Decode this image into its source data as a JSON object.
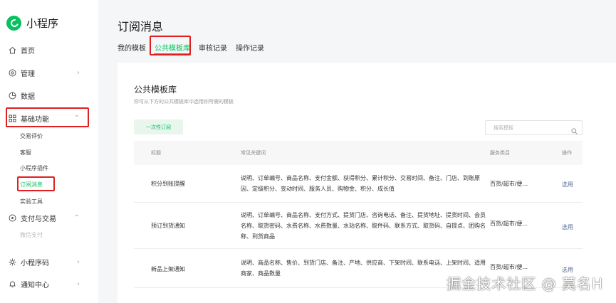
{
  "app": {
    "name": "小程序"
  },
  "sidebar": {
    "items": [
      {
        "label": "首页",
        "icon": "home-icon"
      },
      {
        "label": "管理",
        "icon": "manage-icon"
      },
      {
        "label": "数据",
        "icon": "data-icon"
      },
      {
        "label": "基础功能",
        "icon": "grid-icon"
      },
      {
        "label": "支付与交易",
        "icon": "payment-icon"
      },
      {
        "label": "小程序码",
        "icon": "qrcode-icon"
      },
      {
        "label": "通知中心",
        "icon": "bell-icon"
      }
    ],
    "basic_sub": [
      "交易评价",
      "客服",
      "小程序插件",
      "订阅消息",
      "实验工具"
    ],
    "pay_sub": [
      "微信支付"
    ]
  },
  "header": {
    "title": "订阅消息",
    "tabs": [
      "我的模板",
      "公共模板库",
      "审核记录",
      "操作记录"
    ]
  },
  "main": {
    "title": "公共模板库",
    "subtitle": "你可从下方的公共模板库中选用你所需的模板",
    "once_button": "一次性订阅",
    "search_placeholder": "搜索模板",
    "columns": [
      "标题",
      "常见关键词",
      "服务类目",
      "操作"
    ],
    "rows": [
      {
        "title": "积分到账提醒",
        "keywords": "说明、订单编号、商品名称、支付金额、获得积分、累计积分、交易时间、备注、门店、到账原因、定级积分、变动时间、服务人员、购物金、积分、成长值",
        "category": "百货/超市/便...",
        "action": "选用"
      },
      {
        "title": "预订到货通知",
        "keywords": "说明、订单编号、商品名称、支付方式、提货门店、咨询电话、备注、提货地址、提货时间、会员名称、取货密码、水费名称、水费数量、水站名称、取件码、联系方式、取货码、自提点、团购名称、到货商品",
        "category": "百货/超市/便...",
        "action": "选用"
      },
      {
        "title": "新品上架通知",
        "keywords": "说明、商品名称、售价、到货门店、备注、产地、供应商、下架时间、联系电话、上架时间、适用商家、商品数量",
        "category": "百货/超市/便...",
        "action": "选用"
      }
    ]
  },
  "watermark": "掘金技术社区 @ 莫名H",
  "colors": {
    "accent": "#07c160",
    "highlight": "#e02020",
    "link": "#576b95"
  }
}
